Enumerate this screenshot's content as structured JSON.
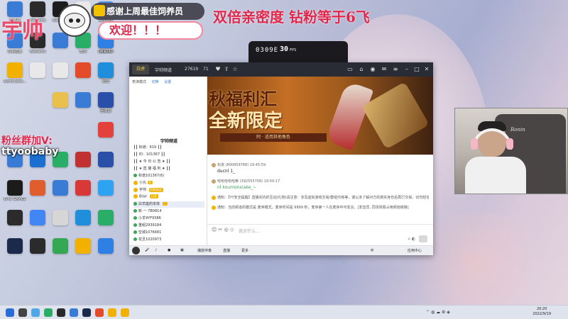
{
  "overlay": {
    "streamer_name": "宇帅",
    "thanks_banner": "感谢上周最佳饲养员",
    "welcome": "欢迎！！！",
    "promo": "双倍亲密度 钻粉等于6飞",
    "fan_group_label": "粉丝群加V:",
    "fan_group_id": "ttyoobaby"
  },
  "fps_widget": {
    "code": "0309E",
    "fps": "30",
    "unit": "FPS"
  },
  "desktop_icons": [
    {
      "label": "此电脑",
      "color": "#3a7bd5"
    },
    {
      "label": "WeGame",
      "color": "#2b2b2b"
    },
    {
      "label": "WeGame",
      "color": "#1c1c1c"
    },
    {
      "label": "",
      "color": "#e8e8e8"
    },
    {
      "label": "百度网盘",
      "color": "#4b8fe8"
    },
    {
      "label": "DEVOUR",
      "color": "#402020"
    },
    {
      "label": "控制面板",
      "color": "#3a7bd5"
    },
    {
      "label": "WeGame",
      "color": "#2b2b2b"
    },
    {
      "label": "",
      "color": "#3a7bd5"
    },
    {
      "label": "微信",
      "color": "#2aae67"
    },
    {
      "label": "网易UU",
      "color": "#2e80e5"
    },
    {
      "label": "迅雷",
      "color": "#3a8fe0"
    },
    {
      "label": "Administra...",
      "color": "#f2b100"
    },
    {
      "label": "",
      "color": "#e8e8e8"
    },
    {
      "label": "",
      "color": "#e8e8e8"
    },
    {
      "label": "",
      "color": "#e34b2a"
    },
    {
      "label": "",
      "color": "#1f8fdb"
    },
    {
      "label": "回收站",
      "color": "#7aa5d6"
    },
    {
      "label": "",
      "color": "#f39c12"
    },
    {
      "label": "",
      "color": "#1e2a78"
    },
    {
      "label": "",
      "color": "#e8c04b"
    },
    {
      "label": "",
      "color": "#3a7bd5"
    },
    {
      "label": "",
      "color": "#2a4fa8"
    },
    {
      "label": "",
      "color": "#e2413c"
    },
    {
      "label": "",
      "color": "#3a7bd5"
    },
    {
      "label": "",
      "color": "#1a6fd0"
    },
    {
      "label": "",
      "color": "#2aae67"
    },
    {
      "label": "",
      "color": "#c23131"
    },
    {
      "label": "",
      "color": "#2a4fa8"
    },
    {
      "label": "EPIC GAMES",
      "color": "#1b1b1b"
    },
    {
      "label": "",
      "color": "#e05d2e"
    },
    {
      "label": "",
      "color": "#3a7bd5"
    },
    {
      "label": "",
      "color": "#d93838"
    },
    {
      "label": "",
      "color": "#2ea3f2"
    },
    {
      "label": "",
      "color": "#2b2b2b"
    },
    {
      "label": "",
      "color": "#4285f4"
    },
    {
      "label": "",
      "color": "#d6d6d6"
    },
    {
      "label": "",
      "color": "#1f8fdb"
    },
    {
      "label": "",
      "color": "#2aae67"
    },
    {
      "label": "",
      "color": "#1b2a4a"
    },
    {
      "label": "",
      "color": "#2b2b2b"
    },
    {
      "label": "",
      "color": "#34a853"
    },
    {
      "label": "",
      "color": "#f2b100"
    },
    {
      "label": "",
      "color": "#2e80e5"
    }
  ],
  "app": {
    "room_badge": "白虎",
    "room_name": "宇帅频道",
    "id_count": "27619",
    "online_count": "71",
    "panel_header": {
      "label": "表演模式",
      "link1": "切换",
      "link2": "设置"
    },
    "tree_title": "宇帅频道",
    "tree_rows": [
      {
        "text": "┃┃ 标谱：619 ┃┃",
        "type": "plain"
      },
      {
        "text": "┃┃ ID：101367 ┃┃",
        "type": "plain"
      },
      {
        "text": "┃┃ ★ 今 日 公 告 ★ ┃┃",
        "type": "plain"
      },
      {
        "text": "┃┃ ★ 直 播 福 利 ★ ┃┃",
        "type": "plain"
      },
      {
        "text": "标谱101367(6)",
        "type": "dot"
      },
      {
        "text": "小丸",
        "type": "ylw",
        "badge": "6"
      },
      {
        "text": "宇帅 ",
        "type": "ylw",
        "badge": "扫码关注"
      },
      {
        "text": "Blair ",
        "type": "ylw",
        "badge": "已关"
      },
      {
        "text": "白羊座的本体 ",
        "type": "hl",
        "badge": "..."
      },
      {
        "text": "新 一 7B0814",
        "type": "dot"
      },
      {
        "text": "小羊9YF9386",
        "type": "dot"
      },
      {
        "text": "重组2939184",
        "type": "dot"
      },
      {
        "text": "空城1076681",
        "type": "dot"
      },
      {
        "text": "花旦1020973",
        "type": "dot"
      }
    ],
    "banner": {
      "line1": "秋福利汇",
      "line2": "全新限定",
      "tag": "阿 · 适用其他角色"
    },
    "chat": [
      {
        "kind": "msg",
        "header": "标谱 (800859788)  19:45:59",
        "text": "ducnl 1_",
        "green": false
      },
      {
        "kind": "msg",
        "header": "哈哈哈哈哈嘛 (392555758)  19:50:17",
        "text": "nl koumonxiake_~",
        "green": true
      },
      {
        "kind": "sys",
        "text": "通知：【YY安全提醒】直播间内的互动(礼物)请注意：涉及虚拟游戏交易/群组代练等，谨以多了解对方的真实身份后再行交易，切勿轻信他人！"
      },
      {
        "kind": "sys",
        "text": "通知：当前频道的模式是 麦序模式，麦序时间是 9999 秒，麦序第一人在麦序中可发言。[发音员, 同场举报占用频道链接]"
      }
    ],
    "input": {
      "placeholder": "说点什么..."
    },
    "bottom_bar": [
      "",
      "",
      "",
      "播放伴奏",
      "直播",
      "更多",
      "",
      "",
      "",
      "",
      "应用中心"
    ]
  },
  "webcam": {
    "chair_brand": "Ronin"
  },
  "taskbar": {
    "time": "20:20",
    "date": "2022/9/19"
  }
}
